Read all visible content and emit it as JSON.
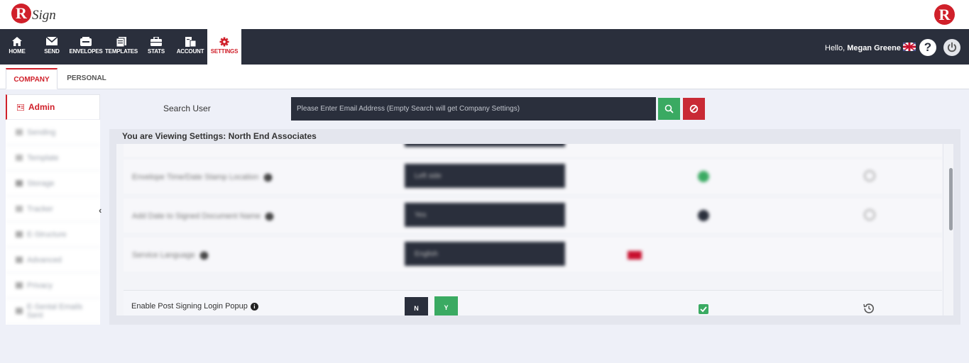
{
  "brand": {
    "logo_letter": "R",
    "logo_text": "Sign",
    "right_logo_letter": "R"
  },
  "nav": {
    "items": [
      {
        "label": "HOME",
        "icon": "home-icon"
      },
      {
        "label": "SEND",
        "icon": "envelope-icon"
      },
      {
        "label": "ENVELOPES",
        "icon": "inbox-icon"
      },
      {
        "label": "TEMPLATES",
        "icon": "templates-icon"
      },
      {
        "label": "STATS",
        "icon": "briefcase-icon"
      },
      {
        "label": "ACCOUNT",
        "icon": "account-icon"
      },
      {
        "label": "SETTINGS",
        "icon": "gear-icon"
      }
    ],
    "greeting_prefix": "Hello,",
    "user_name": "Megan Greene",
    "help_label": "?"
  },
  "tabs": {
    "company": "COMPANY",
    "personal": "PERSONAL"
  },
  "sidebar": {
    "items": [
      {
        "label": "Admin"
      },
      {
        "label": "Sending"
      },
      {
        "label": "Template"
      },
      {
        "label": "Storage"
      },
      {
        "label": "Tracker"
      },
      {
        "label": "E-Structure"
      },
      {
        "label": "Advanced"
      },
      {
        "label": "Privacy"
      },
      {
        "label": "E-Sental Emails Sent"
      }
    ]
  },
  "search": {
    "label": "Search User",
    "placeholder": "Please Enter Email Address (Empty Search will get Company Settings)"
  },
  "panel": {
    "title": "You are Viewing Settings: North End Associates",
    "rows": [
      {
        "label": "Envelope Time/Date Stamp Location",
        "value": "Left side",
        "status_color": "#3aaa62"
      },
      {
        "label": "Add Date to Signed Document Name",
        "value": "Yes",
        "status_color": "#2a2f3c"
      },
      {
        "label": "Service Language",
        "value": "English",
        "status_color": ""
      }
    ],
    "focus_row": {
      "label": "Enable Post Signing Login Popup",
      "btn_n": "N",
      "btn_y": "Y"
    }
  },
  "colors": {
    "accent": "#d0202a",
    "dark": "#2a2f3c",
    "green": "#3aaa62"
  }
}
